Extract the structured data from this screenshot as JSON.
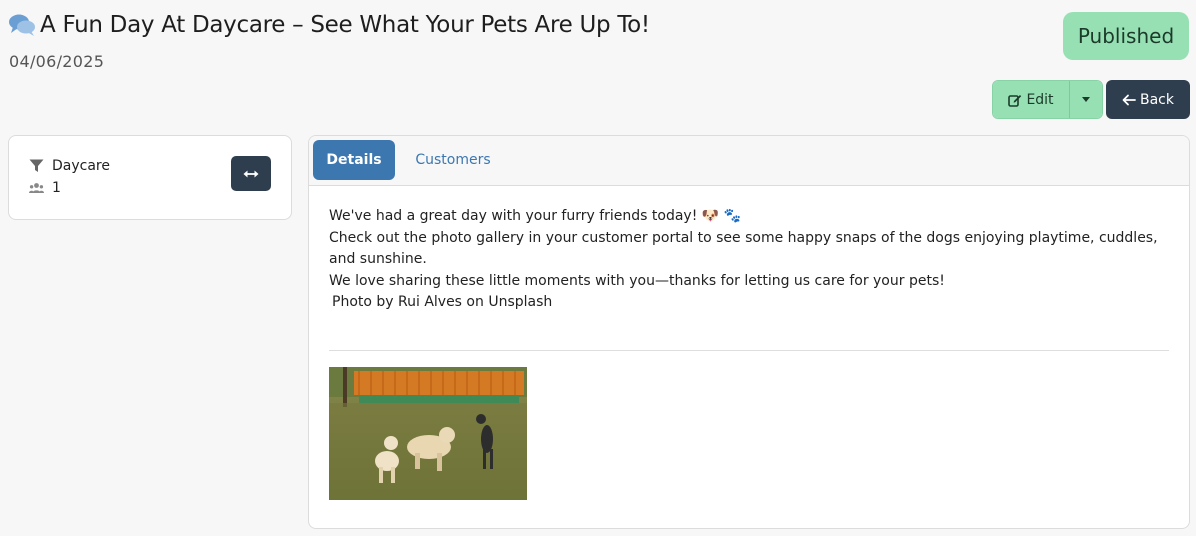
{
  "header": {
    "title": "A Fun Day At Daycare – See What Your Pets Are Up To!",
    "date": "04/06/2025",
    "status": "Published",
    "title_icon": "chat-bubbles-icon"
  },
  "actions": {
    "edit_label": "Edit",
    "back_label": "Back"
  },
  "sidebar": {
    "category": "Daycare",
    "count": "1",
    "category_icon": "filter-icon",
    "count_icon": "users-icon"
  },
  "tabs": [
    {
      "label": "Details",
      "active": true
    },
    {
      "label": "Customers",
      "active": false
    }
  ],
  "details": {
    "line1": "We've had a great day with your furry friends today! 🐶 🐾",
    "line2": "Check out the photo gallery in your customer portal to see some happy snaps of the dogs enjoying playtime, cuddles, and sunshine.",
    "line3": "We love sharing these little moments with you—thanks for letting us care for your pets!",
    "credit": "Photo by Rui Alves on Unsplash"
  },
  "colors": {
    "accent_blue": "#3c77b0",
    "status_green": "#97e0b4",
    "dark_button": "#2f3e4e"
  }
}
